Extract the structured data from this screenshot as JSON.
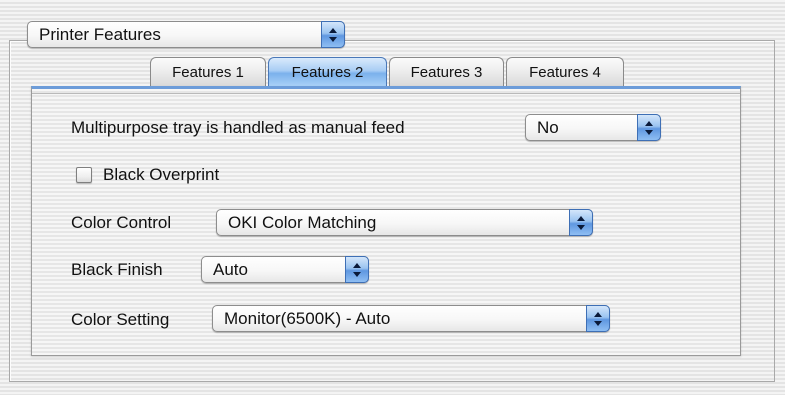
{
  "top_popup": {
    "value": "Printer Features"
  },
  "tabs": [
    {
      "label": "Features 1",
      "active": false
    },
    {
      "label": "Features 2",
      "active": true
    },
    {
      "label": "Features 3",
      "active": false
    },
    {
      "label": "Features 4",
      "active": false
    }
  ],
  "settings": {
    "manual_feed": {
      "label": "Multipurpose tray is handled as manual feed",
      "value": "No"
    },
    "black_overprint": {
      "label": "Black Overprint",
      "checked": false
    },
    "color_control": {
      "label": "Color Control",
      "value": "OKI Color Matching"
    },
    "black_finish": {
      "label": "Black Finish",
      "value": "Auto"
    },
    "color_setting": {
      "label": "Color Setting",
      "value": "Monitor(6500K) - Auto"
    }
  },
  "icons": {
    "popup_arrows": "up-down-arrows-icon"
  },
  "colors": {
    "accent_blue": "#6c9cd9",
    "tab_active": "#a9cdf4"
  }
}
